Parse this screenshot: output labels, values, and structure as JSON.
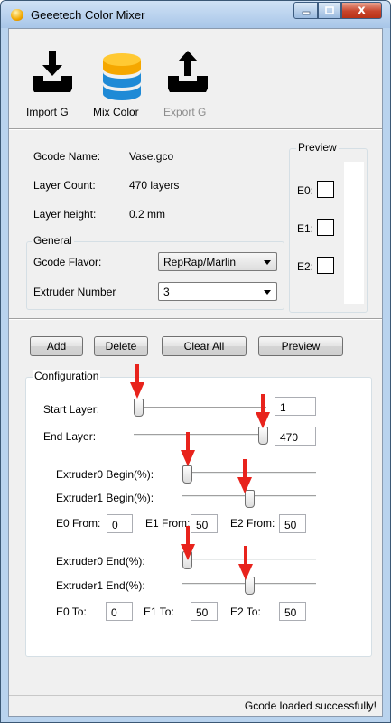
{
  "window": {
    "title": "Geeetech Color Mixer",
    "close_glyph": "x"
  },
  "toolbar": {
    "import_label": "Import G",
    "mix_label": "Mix Color",
    "export_label": "Export G",
    "disabled_color": "#8c8c8c"
  },
  "info": {
    "gcode_name_label": "Gcode Name:",
    "gcode_name_value": "Vase.gco",
    "layer_count_label": "Layer Count:",
    "layer_count_value": "470 layers",
    "layer_height_label": "Layer height:",
    "layer_height_value": "0.2 mm"
  },
  "general": {
    "title": "General",
    "flavor_label": "Gcode Flavor:",
    "flavor_value": "RepRap/Marlin",
    "extruder_label": "Extruder Number",
    "extruder_value": "3"
  },
  "preview": {
    "title": "Preview",
    "e0": "E0:",
    "e1": "E1:",
    "e2": "E2:"
  },
  "buttons": {
    "add": "Add",
    "delete": "Delete",
    "clear_all": "Clear All",
    "preview": "Preview"
  },
  "config": {
    "title": "Configuration",
    "start_layer_label": "Start Layer:",
    "start_layer_value": "1",
    "start_layer_level": 0.0,
    "end_layer_label": "End Layer:",
    "end_layer_value": "470",
    "end_layer_level": 1.0,
    "ext0_begin_label": "Extruder0 Begin(%):",
    "ext0_begin_level": 0.0,
    "ext1_begin_label": "Extruder1 Begin(%):",
    "ext1_begin_level": 0.5,
    "e0_from_label": "E0 From:",
    "e0_from_value": "0",
    "e1_from_label": "E1 From:",
    "e1_from_value": "50",
    "e2_from_label": "E2 From:",
    "e2_from_value": "50",
    "ext0_end_label": "Extruder0 End(%):",
    "ext0_end_level": 0.0,
    "ext1_end_label": "Extruder1 End(%):",
    "ext1_end_level": 0.5,
    "e0_to_label": "E0 To:",
    "e0_to_value": "0",
    "e1_to_label": "E1 To:",
    "e1_to_value": "50",
    "e2_to_label": "E2 To:",
    "e2_to_value": "50",
    "annotation_color": "#e8231c"
  },
  "status": {
    "message": "Gcode loaded successfully!"
  }
}
